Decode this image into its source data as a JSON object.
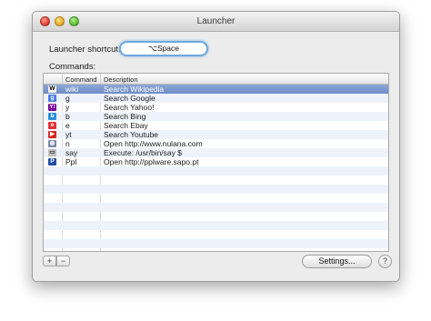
{
  "window": {
    "title": "Launcher"
  },
  "shortcut": {
    "label": "Launcher shortcut:",
    "value": "⌥Space"
  },
  "commands": {
    "label": "Commands:",
    "headers": {
      "command": "Command",
      "description": "Description"
    },
    "rows": [
      {
        "icon": "wikipedia-icon",
        "glyph": "W",
        "color": "#f0f0f0",
        "fg": "#000000",
        "command": "wiki",
        "description": "Search Wikipedia",
        "selected": true
      },
      {
        "icon": "google-icon",
        "glyph": "g",
        "color": "#4a7de2",
        "fg": "#ffffff",
        "command": "g",
        "description": "Search Google"
      },
      {
        "icon": "yahoo-icon",
        "glyph": "Y!",
        "color": "#7b0099",
        "fg": "#ffffff",
        "command": "y",
        "description": "Search Yahoo!"
      },
      {
        "icon": "bing-icon",
        "glyph": "b",
        "color": "#2a8ed6",
        "fg": "#ffffff",
        "command": "b",
        "description": "Search Bing"
      },
      {
        "icon": "ebay-icon",
        "glyph": "e",
        "color": "#e53238",
        "fg": "#ffffff",
        "command": "e",
        "description": "Search Ebay"
      },
      {
        "icon": "youtube-icon",
        "glyph": "▶",
        "color": "#d8261f",
        "fg": "#ffffff",
        "command": "yt",
        "description": "Search Youtube"
      },
      {
        "icon": "globe-icon",
        "glyph": "◍",
        "color": "#7a8aa8",
        "fg": "#ffffff",
        "command": "n",
        "description": "Open http://www.nulana.com"
      },
      {
        "icon": "terminal-icon",
        "glyph": "▭",
        "color": "#bfbfbf",
        "fg": "#333333",
        "command": "say",
        "description": "Execute: /usr/bin/say $"
      },
      {
        "icon": "sapo-icon",
        "glyph": "P",
        "color": "#1f4fa3",
        "fg": "#ffffff",
        "command": "Ppl",
        "description": "Open http://pplware.sapo.pt"
      },
      {},
      {},
      {},
      {},
      {},
      {},
      {},
      {},
      {}
    ]
  },
  "footer": {
    "add_label": "+",
    "remove_label": "−",
    "settings_label": "Settings...",
    "help_label": "?"
  }
}
